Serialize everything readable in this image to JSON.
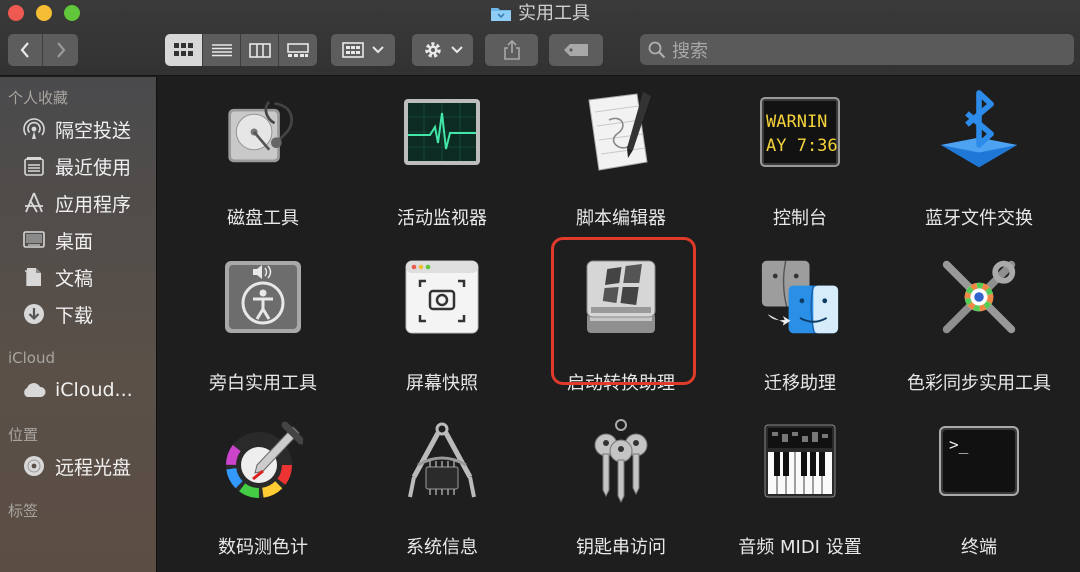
{
  "window": {
    "title": "实用工具"
  },
  "toolbar": {
    "search_placeholder": "搜索",
    "view_modes": [
      "icon-view",
      "list-view",
      "column-view",
      "gallery-view"
    ],
    "active_view": "icon-view"
  },
  "sidebar": {
    "favorites_header": "个人收藏",
    "favorites": [
      {
        "label": "隔空投送",
        "icon": "airdrop-icon"
      },
      {
        "label": "最近使用",
        "icon": "recents-icon"
      },
      {
        "label": "应用程序",
        "icon": "applications-icon"
      },
      {
        "label": "桌面",
        "icon": "desktop-icon"
      },
      {
        "label": "文稿",
        "icon": "documents-icon"
      },
      {
        "label": "下载",
        "icon": "downloads-icon"
      }
    ],
    "icloud_header": "iCloud",
    "icloud": [
      {
        "label": "iCloud...",
        "icon": "cloud-icon"
      }
    ],
    "locations_header": "位置",
    "locations": [
      {
        "label": "远程光盘",
        "icon": "disc-icon"
      }
    ],
    "tags_header": "标签"
  },
  "apps": [
    {
      "name": "磁盘工具",
      "icon": "disk-utility-icon"
    },
    {
      "name": "活动监视器",
      "icon": "activity-monitor-icon"
    },
    {
      "name": "脚本编辑器",
      "icon": "script-editor-icon"
    },
    {
      "name": "控制台",
      "icon": "console-icon",
      "screen_text": [
        "WARNIN",
        "AY 7:36"
      ]
    },
    {
      "name": "蓝牙文件交换",
      "icon": "bluetooth-icon"
    },
    {
      "name": "旁白实用工具",
      "icon": "voiceover-icon"
    },
    {
      "name": "屏幕快照",
      "icon": "screenshot-icon"
    },
    {
      "name": "启动转换助理",
      "icon": "boot-camp-icon",
      "highlighted": true
    },
    {
      "name": "迁移助理",
      "icon": "migration-assistant-icon"
    },
    {
      "name": "色彩同步实用工具",
      "icon": "colorsync-icon"
    },
    {
      "name": "数码测色计",
      "icon": "digital-color-meter-icon"
    },
    {
      "name": "系统信息",
      "icon": "system-information-icon"
    },
    {
      "name": "钥匙串访问",
      "icon": "keychain-icon"
    },
    {
      "name": "音频 MIDI 设置",
      "icon": "audio-midi-icon"
    },
    {
      "name": "终端",
      "icon": "terminal-icon",
      "screen_text": [
        ">_"
      ]
    }
  ],
  "colors": {
    "highlight": "#e03a2a",
    "background": "#1e1e1e"
  }
}
